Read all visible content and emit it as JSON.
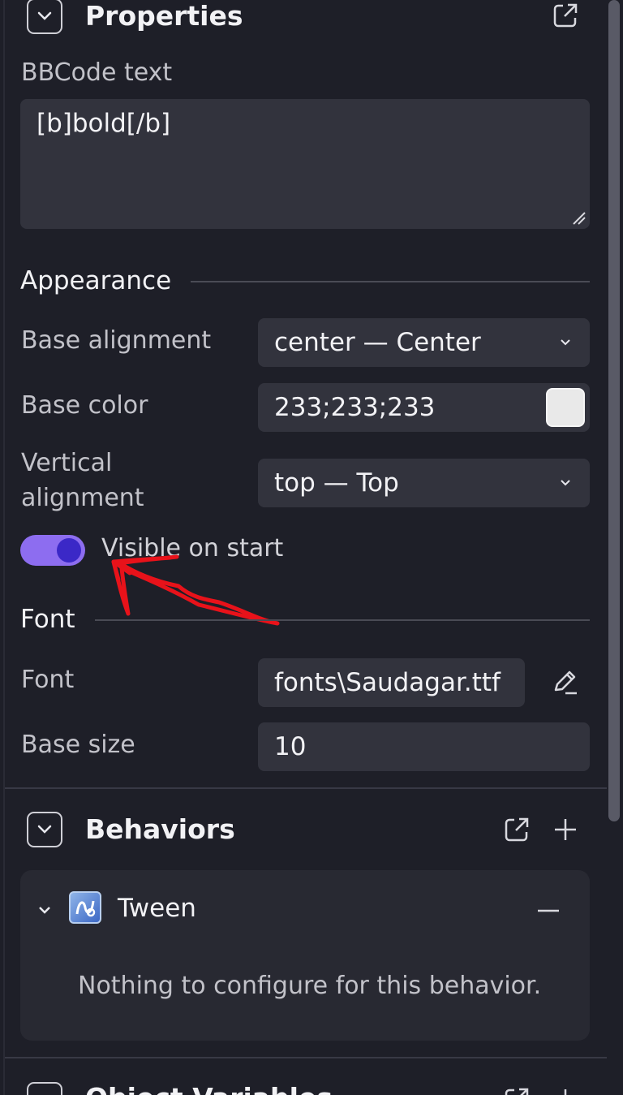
{
  "properties": {
    "title": "Properties",
    "bbcode_label": "BBCode text",
    "bbcode_value": "[b]bold[/b]",
    "appearance_title": "Appearance",
    "base_alignment_label": "Base alignment",
    "base_alignment_value": "center — Center",
    "base_color_label": "Base color",
    "base_color_value": "233;233;233",
    "base_color_swatch": "#e9e9e9",
    "vertical_alignment_label_line1": "Vertical",
    "vertical_alignment_label_line2": "alignment",
    "vertical_alignment_value": "top — Top",
    "visible_on_start_label": "Visible on start",
    "visible_on_start": true,
    "font_group_title": "Font",
    "font_label": "Font",
    "font_value": "fonts\\Saudagar.ttf",
    "base_size_label": "Base size",
    "base_size_value": "10"
  },
  "behaviors": {
    "title": "Behaviors",
    "items": [
      {
        "name": "Tween",
        "message": "Nothing to configure for this behavior."
      }
    ]
  },
  "object_variables": {
    "title": "Object Variables"
  },
  "colors": {
    "accent_toggle": "#8d6df0",
    "annotation_red": "#e8121a"
  },
  "icons": {
    "collapse": "chevron-down-icon",
    "open_external": "external-link-icon",
    "edit": "pencil-icon",
    "add": "plus-icon",
    "remove": "minus-icon"
  }
}
